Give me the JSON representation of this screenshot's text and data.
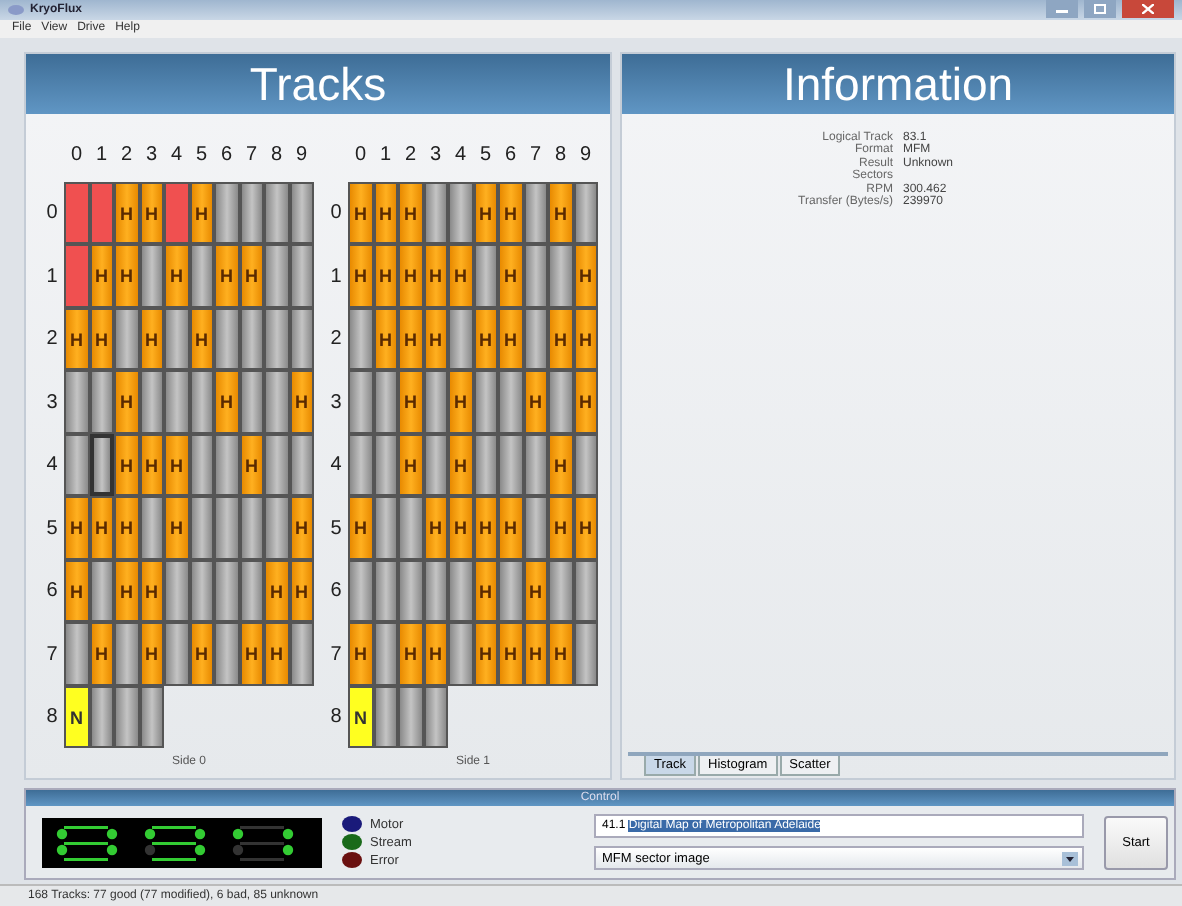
{
  "window": {
    "title": "KryoFlux"
  },
  "menu": [
    "File",
    "View",
    "Drive",
    "Help"
  ],
  "tracks_panel": {
    "title": "Tracks",
    "sides": [
      {
        "label": "Side 0",
        "column_labels": [
          "0",
          "1",
          "2",
          "3",
          "4",
          "5",
          "6",
          "7",
          "8",
          "9"
        ],
        "rows": [
          {
            "label": "0",
            "cells": [
              {
                "kind": "bad",
                "selected": false
              },
              {
                "kind": "bad",
                "selected": false
              },
              {
                "kind": "good",
                "label": "H",
                "selected": false
              },
              {
                "kind": "good",
                "label": "H",
                "selected": false
              },
              {
                "kind": "bad",
                "selected": false
              },
              {
                "kind": "good",
                "label": "H",
                "selected": false
              },
              {
                "kind": "unknown",
                "selected": false
              },
              {
                "kind": "unknown",
                "selected": false
              },
              {
                "kind": "unknown",
                "selected": false
              },
              {
                "kind": "unknown",
                "selected": false
              }
            ]
          },
          {
            "label": "1",
            "cells": [
              {
                "kind": "bad",
                "selected": false
              },
              {
                "kind": "good",
                "label": "H",
                "selected": false
              },
              {
                "kind": "good",
                "label": "H",
                "selected": false
              },
              {
                "kind": "unknown",
                "selected": false
              },
              {
                "kind": "good",
                "label": "H",
                "selected": false
              },
              {
                "kind": "unknown",
                "selected": false
              },
              {
                "kind": "good",
                "label": "H",
                "selected": false
              },
              {
                "kind": "good",
                "label": "H",
                "selected": false
              },
              {
                "kind": "unknown",
                "selected": false
              },
              {
                "kind": "unknown",
                "selected": false
              }
            ]
          },
          {
            "label": "2",
            "cells": [
              {
                "kind": "good",
                "label": "H",
                "selected": false
              },
              {
                "kind": "good",
                "label": "H",
                "selected": false
              },
              {
                "kind": "unknown",
                "selected": false
              },
              {
                "kind": "good",
                "label": "H",
                "selected": false
              },
              {
                "kind": "unknown",
                "selected": false
              },
              {
                "kind": "good",
                "label": "H",
                "selected": false
              },
              {
                "kind": "unknown",
                "selected": false
              },
              {
                "kind": "unknown",
                "selected": false
              },
              {
                "kind": "unknown",
                "selected": false
              },
              {
                "kind": "unknown",
                "selected": false
              }
            ]
          },
          {
            "label": "3",
            "cells": [
              {
                "kind": "unknown",
                "selected": false
              },
              {
                "kind": "unknown",
                "selected": false
              },
              {
                "kind": "good",
                "label": "H",
                "selected": false
              },
              {
                "kind": "unknown",
                "selected": false
              },
              {
                "kind": "unknown",
                "selected": false
              },
              {
                "kind": "unknown",
                "selected": false
              },
              {
                "kind": "good",
                "label": "H",
                "selected": false
              },
              {
                "kind": "unknown",
                "selected": false
              },
              {
                "kind": "unknown",
                "selected": false
              },
              {
                "kind": "good",
                "label": "H",
                "selected": false
              }
            ]
          },
          {
            "label": "4",
            "cells": [
              {
                "kind": "unknown",
                "selected": false
              },
              {
                "kind": "unknown",
                "selected": true
              },
              {
                "kind": "good",
                "label": "H",
                "selected": false
              },
              {
                "kind": "good",
                "label": "H",
                "selected": false
              },
              {
                "kind": "good",
                "label": "H",
                "selected": false
              },
              {
                "kind": "unknown",
                "selected": false
              },
              {
                "kind": "unknown",
                "selected": false
              },
              {
                "kind": "good",
                "label": "H",
                "selected": false
              },
              {
                "kind": "unknown",
                "selected": false
              },
              {
                "kind": "unknown",
                "selected": false
              }
            ]
          },
          {
            "label": "5",
            "cells": [
              {
                "kind": "good",
                "label": "H",
                "selected": false
              },
              {
                "kind": "good",
                "label": "H",
                "selected": false
              },
              {
                "kind": "good",
                "label": "H",
                "selected": false
              },
              {
                "kind": "unknown",
                "selected": false
              },
              {
                "kind": "good",
                "label": "H",
                "selected": false
              },
              {
                "kind": "unknown",
                "selected": false
              },
              {
                "kind": "unknown",
                "selected": false
              },
              {
                "kind": "unknown",
                "selected": false
              },
              {
                "kind": "unknown",
                "selected": false
              },
              {
                "kind": "good",
                "label": "H",
                "selected": false
              }
            ]
          },
          {
            "label": "6",
            "cells": [
              {
                "kind": "good",
                "label": "H",
                "selected": false
              },
              {
                "kind": "unknown",
                "selected": false
              },
              {
                "kind": "good",
                "label": "H",
                "selected": false
              },
              {
                "kind": "good",
                "label": "H",
                "selected": false
              },
              {
                "kind": "unknown",
                "selected": false
              },
              {
                "kind": "unknown",
                "selected": false
              },
              {
                "kind": "unknown",
                "selected": false
              },
              {
                "kind": "unknown",
                "selected": false
              },
              {
                "kind": "good",
                "label": "H",
                "selected": false
              },
              {
                "kind": "good",
                "label": "H",
                "selected": false
              }
            ]
          },
          {
            "label": "7",
            "cells": [
              {
                "kind": "unknown",
                "selected": false
              },
              {
                "kind": "good",
                "label": "H",
                "selected": false
              },
              {
                "kind": "unknown",
                "selected": false
              },
              {
                "kind": "good",
                "label": "H",
                "selected": false
              },
              {
                "kind": "unknown",
                "selected": false
              },
              {
                "kind": "good",
                "label": "H",
                "selected": false
              },
              {
                "kind": "unknown",
                "selected": false
              },
              {
                "kind": "good",
                "label": "H",
                "selected": false
              },
              {
                "kind": "good",
                "label": "H",
                "selected": false
              },
              {
                "kind": "unknown",
                "selected": false
              }
            ]
          },
          {
            "label": "8",
            "cells": [
              {
                "kind": "new",
                "label": "N",
                "selected": false
              },
              {
                "kind": "unknown",
                "selected": false
              },
              {
                "kind": "unknown",
                "selected": false
              },
              {
                "kind": "unknown",
                "selected": false
              }
            ]
          }
        ]
      },
      {
        "label": "Side 1",
        "column_labels": [
          "0",
          "1",
          "2",
          "3",
          "4",
          "5",
          "6",
          "7",
          "8",
          "9"
        ],
        "rows": [
          {
            "label": "0",
            "cells": [
              {
                "kind": "good",
                "label": "H",
                "selected": false
              },
              {
                "kind": "good",
                "label": "H",
                "selected": false
              },
              {
                "kind": "good",
                "label": "H",
                "selected": false
              },
              {
                "kind": "unknown",
                "selected": false
              },
              {
                "kind": "unknown",
                "selected": false
              },
              {
                "kind": "good",
                "label": "H",
                "selected": false
              },
              {
                "kind": "good",
                "label": "H",
                "selected": false
              },
              {
                "kind": "unknown",
                "selected": false
              },
              {
                "kind": "good",
                "label": "H",
                "selected": false
              },
              {
                "kind": "unknown",
                "selected": false
              }
            ]
          },
          {
            "label": "1",
            "cells": [
              {
                "kind": "good",
                "label": "H",
                "selected": false
              },
              {
                "kind": "good",
                "label": "H",
                "selected": false
              },
              {
                "kind": "good",
                "label": "H",
                "selected": false
              },
              {
                "kind": "good",
                "label": "H",
                "selected": false
              },
              {
                "kind": "good",
                "label": "H",
                "selected": false
              },
              {
                "kind": "unknown",
                "selected": false
              },
              {
                "kind": "good",
                "label": "H",
                "selected": false
              },
              {
                "kind": "unknown",
                "selected": false
              },
              {
                "kind": "unknown",
                "selected": false
              },
              {
                "kind": "good",
                "label": "H",
                "selected": false
              }
            ]
          },
          {
            "label": "2",
            "cells": [
              {
                "kind": "unknown",
                "selected": false
              },
              {
                "kind": "good",
                "label": "H",
                "selected": false
              },
              {
                "kind": "good",
                "label": "H",
                "selected": false
              },
              {
                "kind": "good",
                "label": "H",
                "selected": false
              },
              {
                "kind": "unknown",
                "selected": false
              },
              {
                "kind": "good",
                "label": "H",
                "selected": false
              },
              {
                "kind": "good",
                "label": "H",
                "selected": false
              },
              {
                "kind": "unknown",
                "selected": false
              },
              {
                "kind": "good",
                "label": "H",
                "selected": false
              },
              {
                "kind": "good",
                "label": "H",
                "selected": false
              }
            ]
          },
          {
            "label": "3",
            "cells": [
              {
                "kind": "unknown",
                "selected": false
              },
              {
                "kind": "unknown",
                "selected": false
              },
              {
                "kind": "good",
                "label": "H",
                "selected": false
              },
              {
                "kind": "unknown",
                "selected": false
              },
              {
                "kind": "good",
                "label": "H",
                "selected": false
              },
              {
                "kind": "unknown",
                "selected": false
              },
              {
                "kind": "unknown",
                "selected": false
              },
              {
                "kind": "good",
                "label": "H",
                "selected": false
              },
              {
                "kind": "unknown",
                "selected": false
              },
              {
                "kind": "good",
                "label": "H",
                "selected": false
              }
            ]
          },
          {
            "label": "4",
            "cells": [
              {
                "kind": "unknown",
                "selected": false
              },
              {
                "kind": "unknown",
                "selected": false
              },
              {
                "kind": "good",
                "label": "H",
                "selected": false
              },
              {
                "kind": "unknown",
                "selected": false
              },
              {
                "kind": "good",
                "label": "H",
                "selected": false
              },
              {
                "kind": "unknown",
                "selected": false
              },
              {
                "kind": "unknown",
                "selected": false
              },
              {
                "kind": "unknown",
                "selected": false
              },
              {
                "kind": "good",
                "label": "H",
                "selected": false
              },
              {
                "kind": "unknown",
                "selected": false
              }
            ]
          },
          {
            "label": "5",
            "cells": [
              {
                "kind": "good",
                "label": "H",
                "selected": false
              },
              {
                "kind": "unknown",
                "selected": false
              },
              {
                "kind": "unknown",
                "selected": false
              },
              {
                "kind": "good",
                "label": "H",
                "selected": false
              },
              {
                "kind": "good",
                "label": "H",
                "selected": false
              },
              {
                "kind": "good",
                "label": "H",
                "selected": false
              },
              {
                "kind": "good",
                "label": "H",
                "selected": false
              },
              {
                "kind": "unknown",
                "selected": false
              },
              {
                "kind": "good",
                "label": "H",
                "selected": false
              },
              {
                "kind": "good",
                "label": "H",
                "selected": false
              }
            ]
          },
          {
            "label": "6",
            "cells": [
              {
                "kind": "unknown",
                "selected": false
              },
              {
                "kind": "unknown",
                "selected": false
              },
              {
                "kind": "unknown",
                "selected": false
              },
              {
                "kind": "unknown",
                "selected": false
              },
              {
                "kind": "unknown",
                "selected": false
              },
              {
                "kind": "good",
                "label": "H",
                "selected": false
              },
              {
                "kind": "unknown",
                "selected": false
              },
              {
                "kind": "good",
                "label": "H",
                "selected": false
              },
              {
                "kind": "unknown",
                "selected": false
              },
              {
                "kind": "unknown",
                "selected": false
              }
            ]
          },
          {
            "label": "7",
            "cells": [
              {
                "kind": "good",
                "label": "H",
                "selected": false
              },
              {
                "kind": "unknown",
                "selected": false
              },
              {
                "kind": "good",
                "label": "H",
                "selected": false
              },
              {
                "kind": "good",
                "label": "H",
                "selected": false
              },
              {
                "kind": "unknown",
                "selected": false
              },
              {
                "kind": "good",
                "label": "H",
                "selected": false
              },
              {
                "kind": "good",
                "label": "H",
                "selected": false
              },
              {
                "kind": "good",
                "label": "H",
                "selected": false
              },
              {
                "kind": "good",
                "label": "H",
                "selected": false
              },
              {
                "kind": "unknown",
                "selected": false
              }
            ]
          },
          {
            "label": "8",
            "cells": [
              {
                "kind": "new",
                "label": "N",
                "selected": false
              },
              {
                "kind": "unknown",
                "selected": false
              },
              {
                "kind": "unknown",
                "selected": false
              },
              {
                "kind": "unknown",
                "selected": false
              }
            ]
          }
        ]
      }
    ]
  },
  "information_panel": {
    "title": "Information",
    "fields": [
      {
        "label": "Logical Track",
        "value": "83.1"
      },
      {
        "label": "Format",
        "value": "MFM"
      },
      {
        "label": "Result",
        "value": "Unknown"
      },
      {
        "label": "Sectors"
      },
      {
        "label": "RPM",
        "value": "300.462"
      },
      {
        "label": "Transfer (Bytes/s)",
        "value": "239970"
      }
    ],
    "tabs": [
      {
        "label": "Track",
        "selected": true
      },
      {
        "label": "Histogram",
        "selected": false
      },
      {
        "label": "Scatter",
        "selected": false
      }
    ]
  },
  "control": {
    "title": "Control",
    "indicators": [
      {
        "label": "Motor",
        "color": "#1a1a7a"
      },
      {
        "label": "Stream",
        "color": "#1a6a1a"
      },
      {
        "label": "Error",
        "color": "#6a1010"
      }
    ],
    "name_field": {
      "value": "41.1",
      "selected_text": "Digital Map of Metropolitan Adelaide"
    },
    "format_dropdown": {
      "value": "MFM sector image"
    },
    "start_button": "Start"
  },
  "status_bar": "168 Tracks: 77 good (77 modified), 6 bad, 85 unknown"
}
